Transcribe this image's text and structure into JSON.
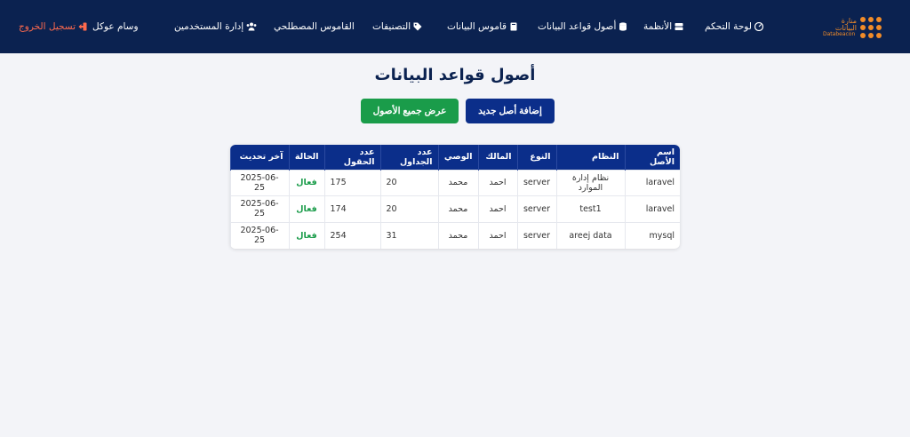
{
  "brand": {
    "ar": "منارة البيانات",
    "en": "Databeacon",
    "color": "#f28c28"
  },
  "nav": {
    "dashboard": "لوحة التحكم",
    "systems": "الأنظمة",
    "assets": "أصول قواعد البيانات",
    "dictionary": "قاموس البيانات",
    "classifications": "التصنيفات",
    "glossary": "القاموس المصطلحي",
    "user_management": "إدارة المستخدمين",
    "username": "وسام عوكل",
    "logout": "تسجيل الخروج"
  },
  "page": {
    "title": "أصول قواعد البيانات",
    "add_button": "إضافة أصل جديد",
    "view_all_button": "عرض جميع الأصول"
  },
  "table": {
    "headers": [
      "اسم الأصل",
      "النظام",
      "النوع",
      "المالك",
      "الوصي",
      "عدد الجداول",
      "عدد الحقول",
      "الحالة",
      "آخر تحديث"
    ],
    "rows": [
      {
        "name": "laravel",
        "system": "نظام إدارة الموارد",
        "type": "server",
        "owner": "احمد",
        "custodian": "محمد",
        "tables": "20",
        "fields": "175",
        "status": "فعال",
        "updated": "2025-06-25"
      },
      {
        "name": "laravel",
        "system": "test1",
        "type": "server",
        "owner": "احمد",
        "custodian": "محمد",
        "tables": "20",
        "fields": "174",
        "status": "فعال",
        "updated": "2025-06-25"
      },
      {
        "name": "mysql",
        "system": "areej data",
        "type": "server",
        "owner": "احمد",
        "custodian": "محمد",
        "tables": "31",
        "fields": "254",
        "status": "فعال",
        "updated": "2025-06-25"
      }
    ]
  },
  "colors": {
    "navbar": "#0b2250",
    "primary": "#0b2e8a",
    "success": "#1a9c4a",
    "logout": "#ff6a4d"
  },
  "icons": [
    "dashboard-icon",
    "database-icon",
    "book-icon",
    "tags-icon",
    "users-icon",
    "logout-icon"
  ]
}
